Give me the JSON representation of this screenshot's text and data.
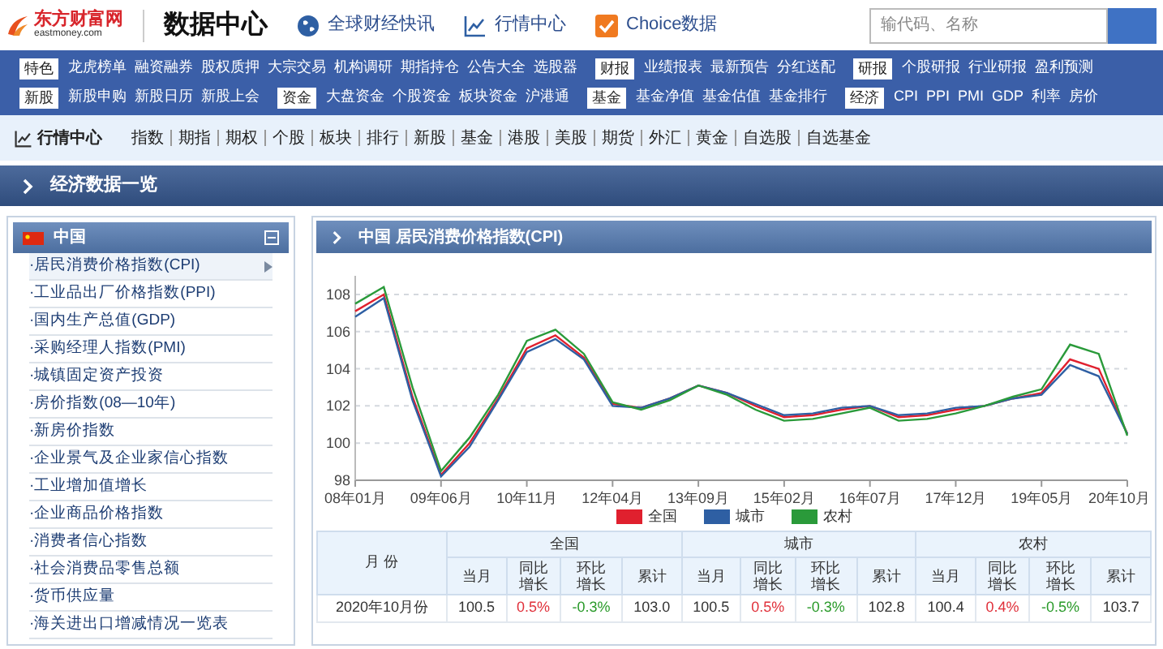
{
  "header": {
    "brand_name": "东方财富网",
    "brand_domain": "eastmoney.com",
    "title": "数据中心",
    "links": [
      {
        "kind": "globe",
        "label": "全球财经快讯"
      },
      {
        "kind": "chart",
        "label": "行情中心"
      },
      {
        "kind": "check",
        "label": "Choice数据"
      }
    ],
    "search": {
      "placeholder": "输代码、名称"
    }
  },
  "nav_rows": [
    [
      {
        "kind": "label",
        "text": "特色"
      },
      {
        "kind": "link",
        "text": "龙虎榜单"
      },
      {
        "kind": "link",
        "text": "融资融券"
      },
      {
        "kind": "link",
        "text": "股权质押"
      },
      {
        "kind": "link",
        "text": "大宗交易"
      },
      {
        "kind": "link",
        "text": "机构调研"
      },
      {
        "kind": "link",
        "text": "期指持仓"
      },
      {
        "kind": "link",
        "text": "公告大全"
      },
      {
        "kind": "link",
        "text": "选股器"
      },
      {
        "kind": "label",
        "text": "财报"
      },
      {
        "kind": "link",
        "text": "业绩报表"
      },
      {
        "kind": "link",
        "text": "最新预告"
      },
      {
        "kind": "link",
        "text": "分红送配"
      },
      {
        "kind": "label",
        "text": "研报"
      },
      {
        "kind": "link",
        "text": "个股研报"
      },
      {
        "kind": "link",
        "text": "行业研报"
      },
      {
        "kind": "link",
        "text": "盈利预测"
      }
    ],
    [
      {
        "kind": "label",
        "text": "新股"
      },
      {
        "kind": "link",
        "text": "新股申购"
      },
      {
        "kind": "link",
        "text": "新股日历"
      },
      {
        "kind": "link",
        "text": "新股上会"
      },
      {
        "kind": "label",
        "text": "资金"
      },
      {
        "kind": "link",
        "text": "大盘资金"
      },
      {
        "kind": "link",
        "text": "个股资金"
      },
      {
        "kind": "link",
        "text": "板块资金"
      },
      {
        "kind": "link",
        "text": "沪港通"
      },
      {
        "kind": "label",
        "text": "基金"
      },
      {
        "kind": "link",
        "text": "基金净值"
      },
      {
        "kind": "link",
        "text": "基金估值"
      },
      {
        "kind": "link",
        "text": "基金排行"
      },
      {
        "kind": "label",
        "text": "经济"
      },
      {
        "kind": "link",
        "text": "CPI"
      },
      {
        "kind": "link",
        "text": "PPI"
      },
      {
        "kind": "link",
        "text": "PMI"
      },
      {
        "kind": "link",
        "text": "GDP"
      },
      {
        "kind": "link",
        "text": "利率"
      },
      {
        "kind": "link",
        "text": "房价"
      }
    ]
  ],
  "sub_nav": {
    "title": "行情中心",
    "links": [
      "指数",
      "期指",
      "期权",
      "个股",
      "板块",
      "排行",
      "新股",
      "基金",
      "港股",
      "美股",
      "期货",
      "外汇",
      "黄金",
      "自选股",
      "自选基金"
    ]
  },
  "section_title": "经济数据一览",
  "sidebar": {
    "title": "中国",
    "items": [
      {
        "label": "·居民消费价格指数(CPI)",
        "selected": true
      },
      {
        "label": "·工业品出厂价格指数(PPI)",
        "selected": false
      },
      {
        "label": "·国内生产总值(GDP)",
        "selected": false
      },
      {
        "label": "·采购经理人指数(PMI)",
        "selected": false
      },
      {
        "label": "·城镇固定资产投资",
        "selected": false
      },
      {
        "label": "·房价指数(08—10年)",
        "selected": false
      },
      {
        "label": "·新房价指数",
        "selected": false
      },
      {
        "label": "·企业景气及企业家信心指数",
        "selected": false
      },
      {
        "label": "·工业增加值增长",
        "selected": false
      },
      {
        "label": "·企业商品价格指数",
        "selected": false
      },
      {
        "label": "·消费者信心指数",
        "selected": false
      },
      {
        "label": "·社会消费品零售总额",
        "selected": false
      },
      {
        "label": "·货币供应量",
        "selected": false
      },
      {
        "label": "·海关进出口增减情况一览表",
        "selected": false
      }
    ]
  },
  "panel": {
    "title": "中国 居民消费价格指数(CPI)",
    "chart_data": {
      "type": "line",
      "categories": [
        "08年01月",
        null,
        null,
        "09年06月",
        null,
        null,
        "10年11月",
        null,
        null,
        "12年04月",
        null,
        null,
        "13年09月",
        null,
        null,
        "15年02月",
        null,
        null,
        "16年07月",
        null,
        null,
        "17年12月",
        null,
        null,
        "19年05月",
        null,
        null,
        "20年10月"
      ],
      "series": [
        {
          "name": "全国",
          "color": "#e0202e",
          "values": [
            107.1,
            108.0,
            102.5,
            98.3,
            100.0,
            102.4,
            105.1,
            105.8,
            104.6,
            102.1,
            101.9,
            102.4,
            103.1,
            102.7,
            102.0,
            101.4,
            101.5,
            101.8,
            102.0,
            101.4,
            101.5,
            101.8,
            102.0,
            102.4,
            102.7,
            104.5,
            104.0,
            100.5
          ]
        },
        {
          "name": "城市",
          "color": "#2e5fa3",
          "values": [
            106.8,
            107.8,
            102.3,
            98.2,
            99.8,
            102.3,
            104.9,
            105.6,
            104.5,
            102.0,
            101.9,
            102.4,
            103.1,
            102.7,
            102.1,
            101.5,
            101.6,
            101.9,
            102.0,
            101.5,
            101.6,
            101.9,
            102.0,
            102.4,
            102.6,
            104.2,
            103.6,
            100.5
          ]
        },
        {
          "name": "农村",
          "color": "#2a9a3a",
          "values": [
            107.5,
            108.4,
            103.0,
            98.5,
            100.3,
            102.6,
            105.5,
            106.1,
            104.8,
            102.2,
            101.8,
            102.3,
            103.1,
            102.6,
            101.8,
            101.2,
            101.3,
            101.6,
            101.9,
            101.2,
            101.3,
            101.6,
            102.0,
            102.5,
            102.9,
            105.3,
            104.8,
            100.4
          ]
        }
      ],
      "ylim": [
        98,
        109
      ],
      "yticks": [
        98,
        100,
        102,
        104,
        106,
        108
      ],
      "grid": true,
      "legend": "bottom"
    },
    "table": {
      "month_header": "月 份",
      "groups": [
        {
          "name": "全国",
          "columns": [
            "当月",
            "同比增长",
            "环比增长",
            "累计"
          ]
        },
        {
          "name": "城市",
          "columns": [
            "当月",
            "同比增长",
            "环比增长",
            "累计"
          ]
        },
        {
          "name": "农村",
          "columns": [
            "当月",
            "同比增长",
            "环比增长",
            "累计"
          ]
        }
      ],
      "rows": [
        {
          "month": "2020年10月份",
          "cells": [
            {
              "text": "100.5"
            },
            {
              "text": "0.5%",
              "color": "#e0303a"
            },
            {
              "text": "-0.3%",
              "color": "#2a9a2a"
            },
            {
              "text": "103.0"
            },
            {
              "text": "100.5"
            },
            {
              "text": "0.5%",
              "color": "#e0303a"
            },
            {
              "text": "-0.3%",
              "color": "#2a9a2a"
            },
            {
              "text": "102.8"
            },
            {
              "text": "100.4"
            },
            {
              "text": "0.4%",
              "color": "#e0303a"
            },
            {
              "text": "-0.5%",
              "color": "#2a9a2a"
            },
            {
              "text": "103.7"
            }
          ]
        }
      ]
    }
  }
}
